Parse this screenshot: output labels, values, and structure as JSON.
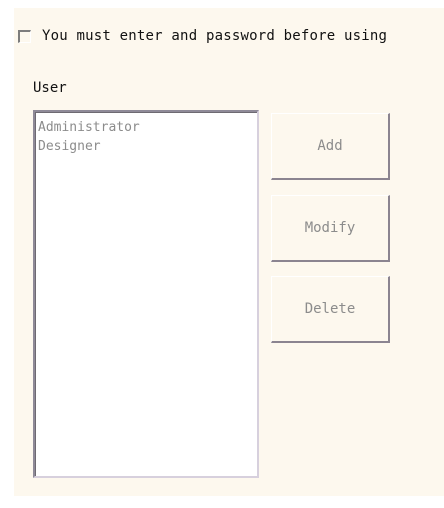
{
  "login_option": {
    "checkbox_label": "You must enter and password before using",
    "checked": false
  },
  "user_section": {
    "label": "User",
    "users": [
      "Administrator",
      "Designer"
    ]
  },
  "buttons": {
    "add": "Add",
    "modify": "Modify",
    "delete": "Delete"
  }
}
